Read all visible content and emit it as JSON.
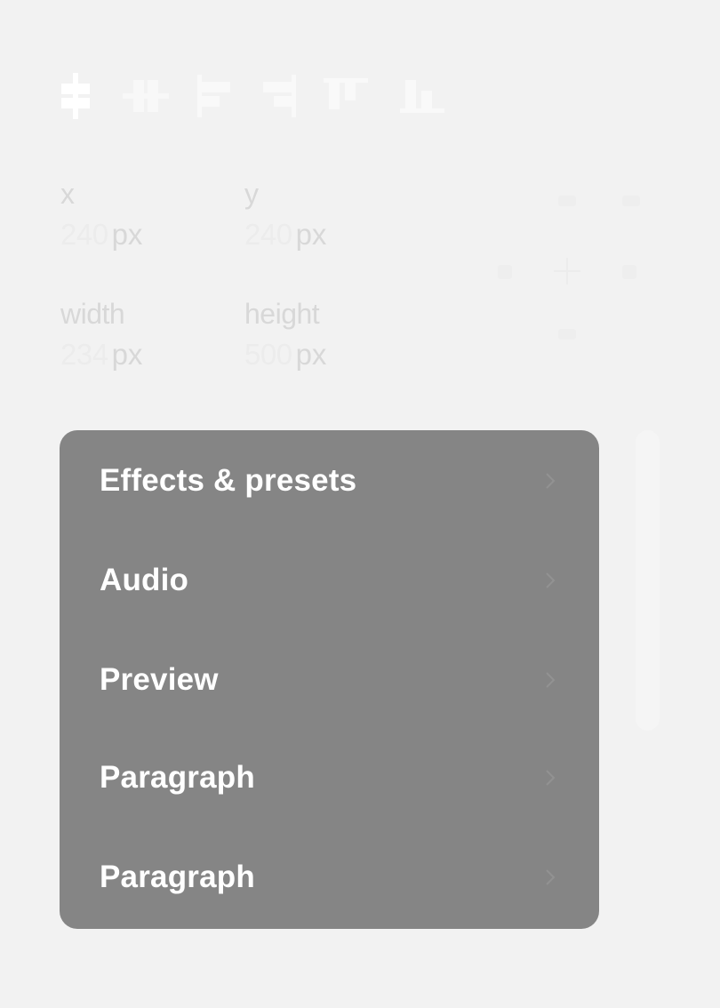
{
  "toolbar": {
    "items": [
      {
        "icon": "align-center-horizontal-icon"
      },
      {
        "icon": "align-center-vertical-icon"
      },
      {
        "icon": "align-left-icon"
      },
      {
        "icon": "align-right-icon"
      },
      {
        "icon": "align-top-icon"
      },
      {
        "icon": "align-bottom-icon"
      }
    ]
  },
  "fields": {
    "x": {
      "label": "x",
      "value": "240",
      "unit": "px"
    },
    "y": {
      "label": "y",
      "value": "240",
      "unit": "px"
    },
    "width": {
      "label": "width",
      "value": "234",
      "unit": "px"
    },
    "height": {
      "label": "height",
      "value": "500",
      "unit": "px"
    }
  },
  "menu": {
    "items": [
      {
        "label": "Effects & presets"
      },
      {
        "label": "Audio"
      },
      {
        "label": "Preview"
      },
      {
        "label": "Paragraph"
      },
      {
        "label": "Paragraph"
      }
    ]
  },
  "colors": {
    "background": "#f2f2f2",
    "menu_background": "#858585",
    "menu_text": "#ffffff",
    "faint_text": "#d8d8d8"
  }
}
